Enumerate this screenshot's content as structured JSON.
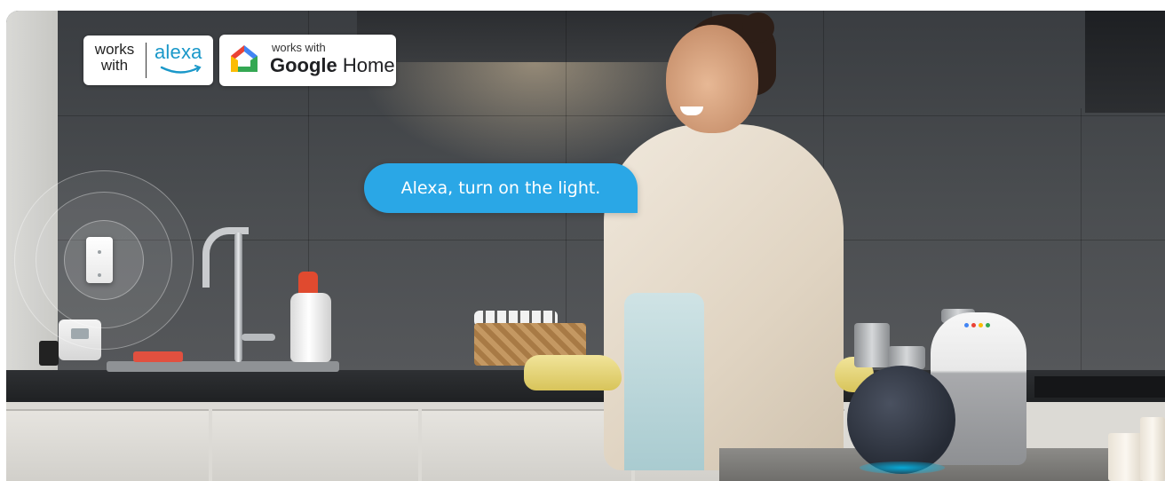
{
  "badges": {
    "alexa": {
      "works_with": "works with",
      "logo_text": "alexa",
      "logo_color": "#1a98c9"
    },
    "google_home": {
      "works_with": "works with",
      "brand_google": "Google",
      "brand_home": "Home",
      "icon": "google-home-icon"
    }
  },
  "speech_bubble": {
    "text": "Alexa, turn on the light.",
    "color": "#2aa7e6"
  },
  "devices": {
    "smart_switch": "smart-light-switch",
    "speaker_echo": "amazon-echo-speaker",
    "speaker_google": "google-home-speaker"
  }
}
